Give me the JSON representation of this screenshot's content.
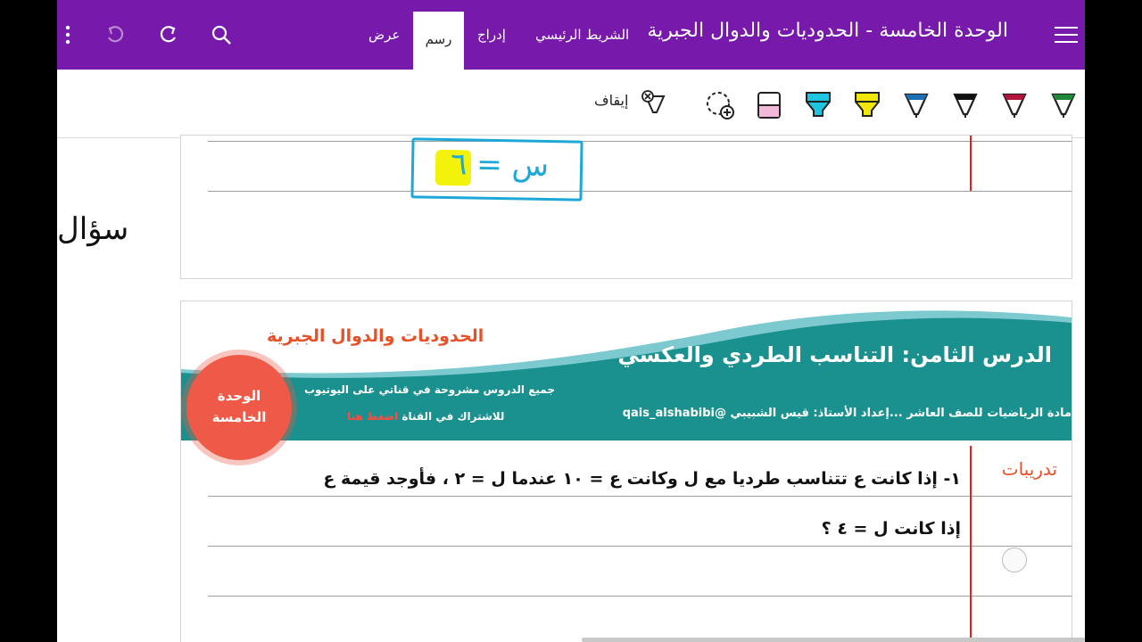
{
  "titlebar": {
    "doc_title": "الوحدة الخامسة - الحدوديات والدوال الجبرية",
    "tabs": {
      "home": "الشريط الرئيسي",
      "insert": "إدراج",
      "draw": "رسم",
      "view": "عرض"
    },
    "icons": [
      "hamburger-menu-icon",
      "search-icon",
      "redo-icon",
      "undo-icon",
      "more-options-icon"
    ]
  },
  "ribbon": {
    "stop_label": "إيقاف",
    "pens": [
      {
        "name": "pen-green",
        "color": "#1f8a3a"
      },
      {
        "name": "pen-red",
        "color": "#b3133d"
      },
      {
        "name": "pen-black",
        "color": "#111111"
      },
      {
        "name": "pen-blue",
        "color": "#1c6fb3"
      },
      {
        "name": "highlighter-yellow",
        "color": "#f2e70a"
      },
      {
        "name": "highlighter-cyan",
        "color": "#1ec5e0"
      },
      {
        "name": "highlighter-pink",
        "color": "#f1b8d8"
      }
    ],
    "selected_pen": "highlighter-yellow"
  },
  "page": {
    "handwriting_top": "س = ٦",
    "handwriting_side": "سؤال",
    "banner": {
      "title": "الدرس الثامن: التناسب الطردي والعكسي",
      "topic": "الحدوديات والدوال الجبرية",
      "line1": "جميع الدروس مشروحة في قناتي على اليوتيوب",
      "line2": "مادة الرياضيات للصف العاشر ...إعداد الأستاذ: قيس الشبيبي @qais_alshabibi",
      "line3_prefix": "للاشتراك في القناة",
      "line3_link": "اضغط هنا",
      "badge_line1": "الوحدة",
      "badge_line2": "الخامسة"
    },
    "drills_label": "تدريبات",
    "question_line1": "١- إذا كانت ع تتناسب طرديا مع ل وكانت ع = ١٠ عندما ل = ٢ ، فأوجد قيمة ع",
    "question_line2": "إذا كانت ل = ٤ ؟"
  },
  "colors": {
    "accent": "#7719aa",
    "banner_teal": "#1a918e",
    "banner_highlight": "#e65128",
    "margin_line": "#d22222"
  }
}
